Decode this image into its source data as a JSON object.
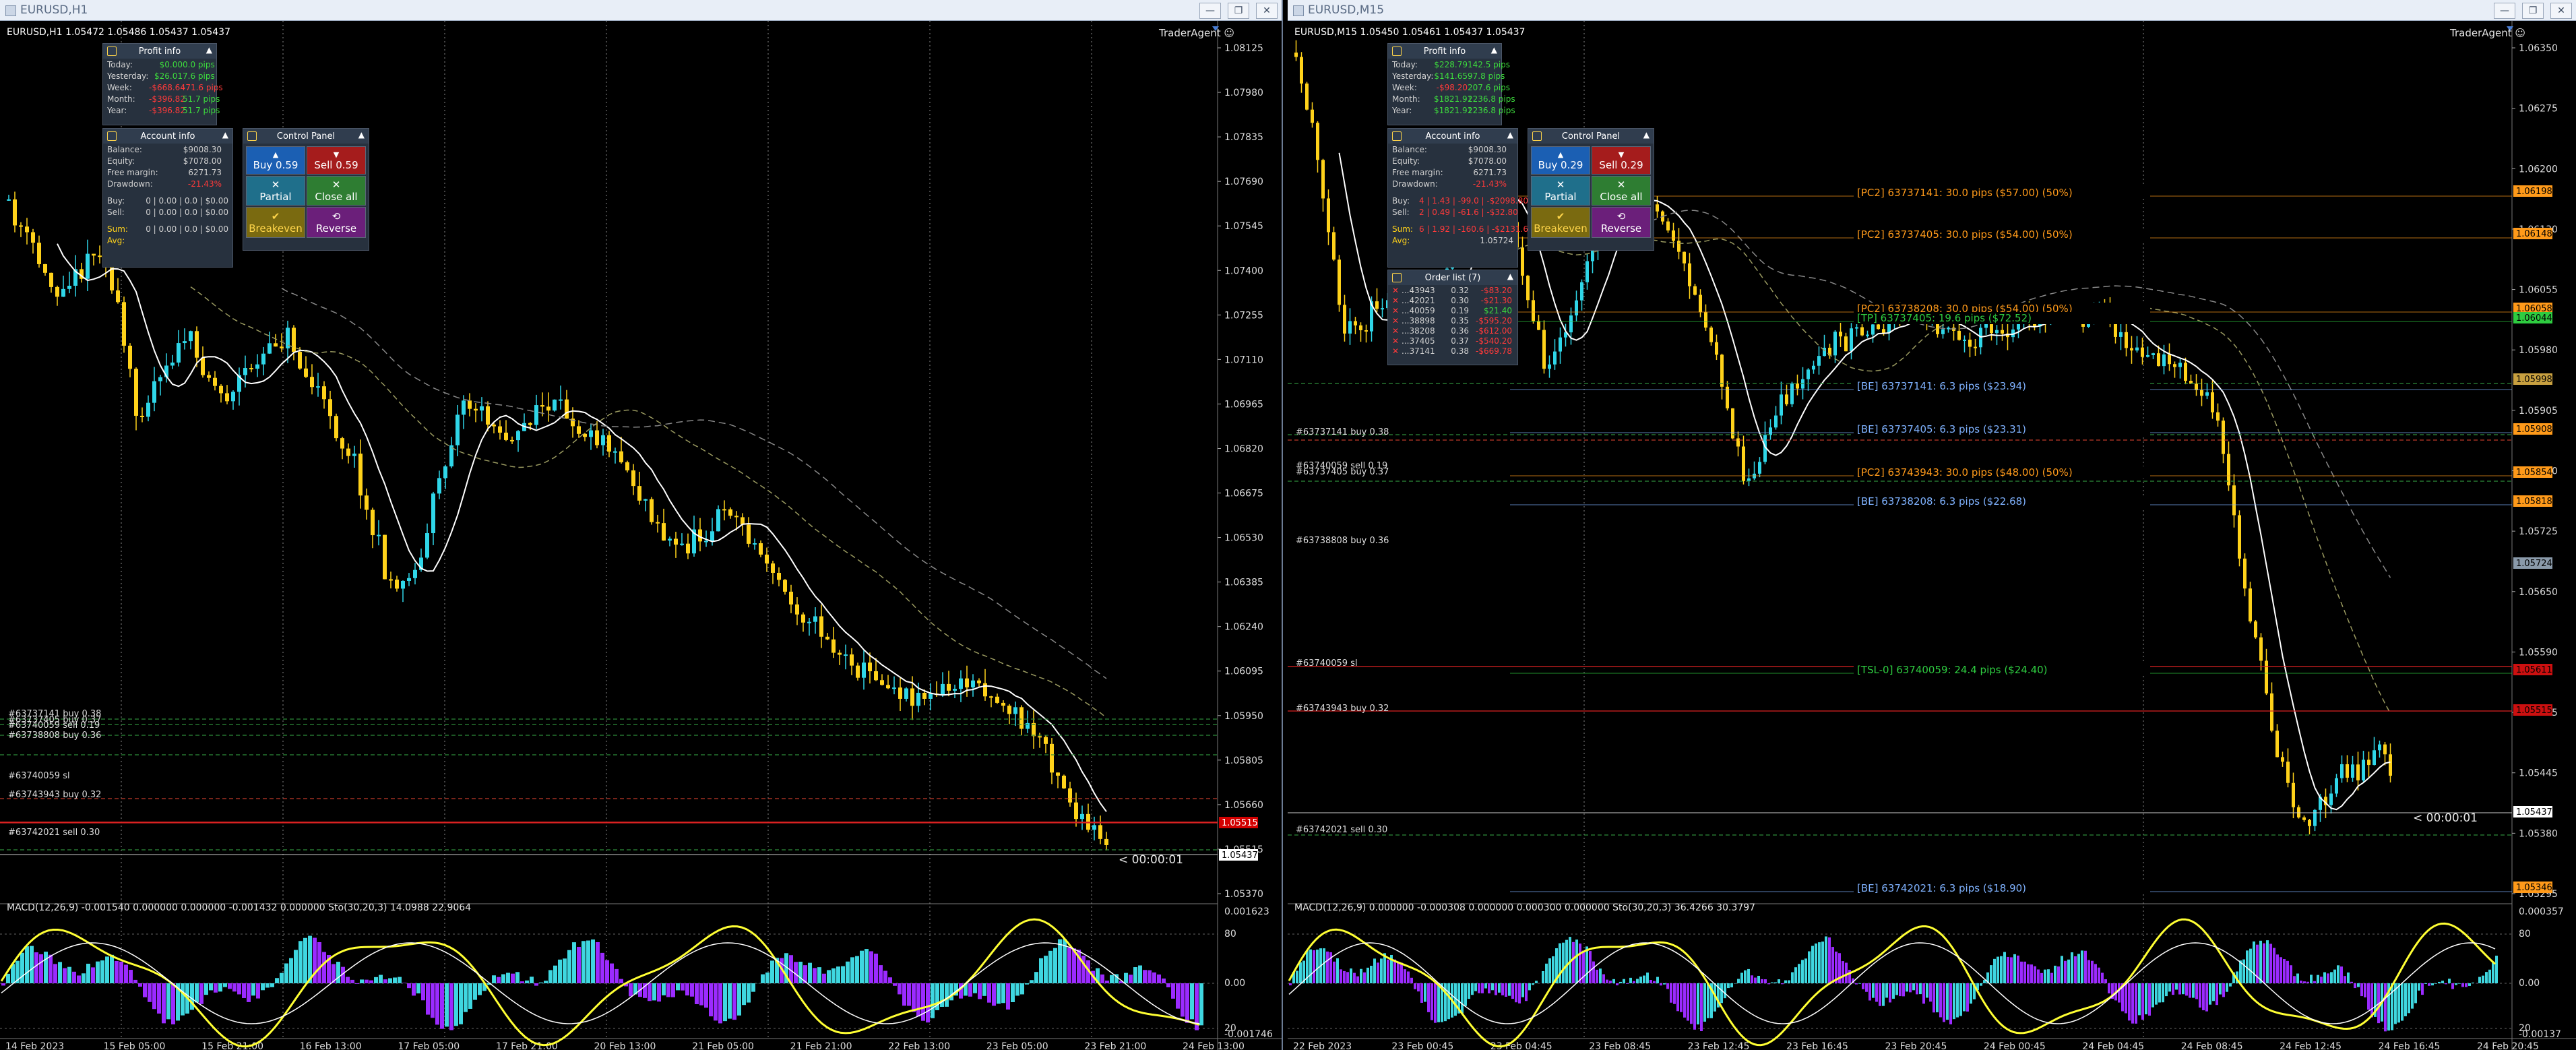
{
  "left": {
    "window_title": "EURUSD,H1",
    "header": "EURUSD,H1  1.05472 1.05486 1.05437 1.05437",
    "trader_agent": "TraderAgent",
    "price_ticks": [
      "1.08125",
      "1.07980",
      "1.07835",
      "1.07690",
      "1.07545",
      "1.07400",
      "1.07255",
      "1.07110",
      "1.06965",
      "1.06820",
      "1.06675",
      "1.06530",
      "1.06385",
      "1.06240",
      "1.06095",
      "1.05950",
      "1.05805",
      "1.05660",
      "1.05515",
      "1.05370"
    ],
    "current_price": "1.05437",
    "sl_price": "1.05515",
    "countdown": "< 00:00:01",
    "time_ticks": [
      "14 Feb 2023",
      "15 Feb 05:00",
      "15 Feb 21:00",
      "16 Feb 13:00",
      "17 Feb 05:00",
      "17 Feb 21:00",
      "20 Feb 13:00",
      "21 Feb 05:00",
      "21 Feb 21:00",
      "22 Feb 13:00",
      "23 Feb 05:00",
      "23 Feb 21:00",
      "24 Feb 13:00"
    ],
    "order_labels": [
      "#63737141 buy 0.38",
      "#63737405 buy 0.37",
      "#63740059 sell 0.19",
      "#63738808 buy 0.36",
      "#63740059 sl",
      "#63743943 buy 0.32",
      "#63742021 sell 0.30"
    ],
    "indicator": "MACD(12,26,9) -0.001540 0.000000 0.000000 -0.001432 0.000000  Sto(30,20,3) 14.0988 22.9064",
    "ind_ticks": [
      "0.001623",
      "80",
      "0.00",
      "20",
      "-0.001746"
    ],
    "profit_info": {
      "title": "Profit info",
      "rows": [
        {
          "label": "Today:",
          "money": "$0.00",
          "pips": "0.0 pips"
        },
        {
          "label": "Yesterday:",
          "money": "$26.01",
          "pips": "7.6 pips"
        },
        {
          "label": "Week:",
          "money": "-$668.64",
          "pips": "-71.6 pips"
        },
        {
          "label": "Month:",
          "money": "-$396.82",
          "pips": "51.7 pips"
        },
        {
          "label": "Year:",
          "money": "-$396.82",
          "pips": "51.7 pips"
        }
      ]
    },
    "account_info": {
      "title": "Account info",
      "rows": [
        {
          "label": "Balance:",
          "value": "$9008.30"
        },
        {
          "label": "Equity:",
          "value": "$7078.00"
        },
        {
          "label": "Free margin:",
          "value": "6271.73"
        },
        {
          "label": "Drawdown:",
          "value": "-21.43%"
        }
      ],
      "buy": "0 | 0.00 | 0.0 | $0.00",
      "sell": "0 | 0.00 | 0.0 | $0.00",
      "sum": "0 | 0.00 | 0.0 | $0.00",
      "buy_label": "Buy:",
      "sell_label": "Sell:",
      "sum_label": "Sum:",
      "avg_label": "Avg:"
    },
    "control_panel": {
      "title": "Control Panel",
      "buy": "Buy 0.59",
      "sell": "Sell 0.59",
      "partial": "Partial",
      "close_all": "Close all",
      "breakeven": "Breakeven",
      "reverse": "Reverse"
    }
  },
  "right": {
    "window_title": "EURUSD,M15",
    "header": "EURUSD,M15  1.05450 1.05461 1.05437 1.05437",
    "trader_agent": "TraderAgent",
    "price_ticks": [
      "1.06350",
      "1.06275",
      "1.06200",
      "1.06130",
      "1.06055",
      "1.05980",
      "1.05905",
      "1.05830",
      "1.05725",
      "1.05650",
      "1.05590",
      "1.05515",
      "1.05445",
      "1.05380",
      "1.05295"
    ],
    "countdown": "< 00:00:01",
    "time_ticks": [
      "22 Feb 2023",
      "23 Feb 00:45",
      "23 Feb 04:45",
      "23 Feb 08:45",
      "23 Feb 12:45",
      "23 Feb 16:45",
      "23 Feb 20:45",
      "24 Feb 00:45",
      "24 Feb 04:45",
      "24 Feb 08:45",
      "24 Feb 12:45",
      "24 Feb 16:45",
      "24 Feb 20:45"
    ],
    "order_labels": [
      "#63737141 buy 0.38",
      "#63740059 sell 0.19",
      "#63737405 buy 0.37",
      "#63738808 buy 0.36",
      "#63740059 sl",
      "#63743943 buy 0.32",
      "#63742021 sell 0.30"
    ],
    "line_labels": [
      {
        "text": "[PC2] 63737141: 30.0 pips ($57.00) (50%)",
        "color": "#ff9a1a"
      },
      {
        "text": "[PC2] 63737405: 30.0 pips ($54.00) (50%)",
        "color": "#ff9a1a"
      },
      {
        "text": "[PC2] 63738208: 30.0 pips ($54.00) (50%)",
        "color": "#ff9a1a"
      },
      {
        "text": "[TP] 63737405: 19.6 pips ($72.52)",
        "color": "#2ecc40"
      },
      {
        "text": "[BE] 63737141: 6.3 pips ($23.94)",
        "color": "#7fb2ff"
      },
      {
        "text": "[BE] 63737405: 6.3 pips ($23.31)",
        "color": "#7fb2ff"
      },
      {
        "text": "[PC2] 63743943: 30.0 pips ($48.00) (50%)",
        "color": "#ff9a1a"
      },
      {
        "text": "[BE] 63738208: 6.3 pips ($22.68)",
        "color": "#7fb2ff"
      },
      {
        "text": "[TSL-0] 63740059: 24.4 pips ($24.40)",
        "color": "#2ecc40"
      },
      {
        "text": "[BE] 63742021: 6.3 pips ($18.90)",
        "color": "#7fb2ff"
      }
    ],
    "price_boxes": [
      {
        "text": "1.06198",
        "color": "#ff9a1a"
      },
      {
        "text": "1.06148",
        "color": "#ff9a1a"
      },
      {
        "text": "1.06058",
        "color": "#ff9a1a"
      },
      {
        "text": "1.06044",
        "color": "#2ecc40"
      },
      {
        "text": "1.05998",
        "color": "#c8a040"
      },
      {
        "text": "1.05908",
        "color": "#ff9a1a"
      },
      {
        "text": "1.05854",
        "color": "#ff9a1a"
      },
      {
        "text": "1.05818",
        "color": "#ff9a1a"
      },
      {
        "text": "1.05724",
        "color": "#8a9aaa"
      },
      {
        "text": "1.05611",
        "color": "#cc1010"
      },
      {
        "text": "1.05515",
        "color": "#cc1010"
      },
      {
        "text": "1.05437",
        "color": "#ffffff"
      },
      {
        "text": "1.05346",
        "color": "#ff9a1a"
      }
    ],
    "indicator": "MACD(12,26,9) 0.000000 -0.000308 0.000000 0.000300 0.000000  Sto(30,20,3) 36.4266 30.3797",
    "ind_ticks": [
      "0.000357",
      "80",
      "0.00",
      "20",
      "-0.00137"
    ],
    "profit_info": {
      "title": "Profit info",
      "rows": [
        {
          "label": "Today:",
          "money": "$228.79",
          "pips": "142.5 pips"
        },
        {
          "label": "Yesterday:",
          "money": "$141.65",
          "pips": "97.8 pips"
        },
        {
          "label": "Week:",
          "money": "-$98.20",
          "pips": "207.6 pips"
        },
        {
          "label": "Month:",
          "money": "$1821.91",
          "pips": "2236.8 pips"
        },
        {
          "label": "Year:",
          "money": "$1821.91",
          "pips": "2236.8 pips"
        }
      ]
    },
    "account_info": {
      "title": "Account info",
      "rows": [
        {
          "label": "Balance:",
          "value": "$9008.30"
        },
        {
          "label": "Equity:",
          "value": "$7078.00"
        },
        {
          "label": "Free margin:",
          "value": "6271.73"
        },
        {
          "label": "Drawdown:",
          "value": "-21.43%"
        }
      ],
      "buy": "4 | 1.43 | -99.0 | -$2098.80",
      "sell": "2 | 0.49 | -61.6 | -$32.80",
      "sum": "6 | 1.92 | -160.6 | -$2131.60",
      "avg": "1.05724",
      "buy_label": "Buy:",
      "sell_label": "Sell:",
      "sum_label": "Sum:",
      "avg_label": "Avg:"
    },
    "control_panel": {
      "title": "Control Panel",
      "buy": "Buy 0.29",
      "sell": "Sell 0.29",
      "partial": "Partial",
      "close_all": "Close all",
      "breakeven": "Breakeven",
      "reverse": "Reverse"
    },
    "order_list": {
      "title": "Order list (7)",
      "rows": [
        {
          "id": "...43943",
          "lots": "0.32",
          "pl": "-$83.20"
        },
        {
          "id": "...42021",
          "lots": "0.30",
          "pl": "-$21.30"
        },
        {
          "id": "...40059",
          "lots": "0.19",
          "pl": "$21.40"
        },
        {
          "id": "...38898",
          "lots": "0.35",
          "pl": "-$595.20"
        },
        {
          "id": "...38208",
          "lots": "0.36",
          "pl": "-$612.00"
        },
        {
          "id": "...37405",
          "lots": "0.37",
          "pl": "-$540.20"
        },
        {
          "id": "...37141",
          "lots": "0.38",
          "pl": "-$669.78"
        }
      ]
    }
  },
  "colors": {
    "bull": "#2fd6e8",
    "bear": "#ffd21a",
    "macd_up": "#3fd7e0",
    "macd_down": "#9b2bff",
    "sto": "#ffff33",
    "signal": "#ffffff"
  }
}
